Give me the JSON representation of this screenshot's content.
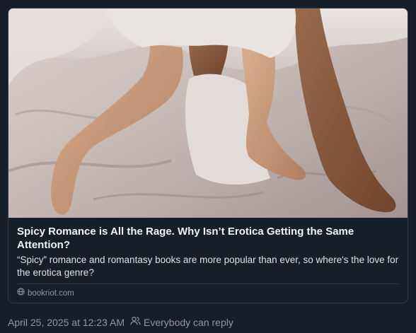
{
  "post": {
    "link_card": {
      "image_alt": "Two pairs of bare legs and feet under rumpled white bed sheets",
      "title": "Spicy Romance is All the Rage. Why Isn’t Erotica Getting the Same Attention?",
      "description": "“Spicy” romance and romantasy books are more popular than ever, so where's the love for the erotica genre?",
      "domain": "bookriot.com",
      "domain_icon": "globe-icon"
    },
    "timestamp": "April 25, 2025 at 12:23 AM",
    "reply_setting": {
      "icon": "people-icon",
      "label": "Everybody can reply"
    }
  },
  "colors": {
    "background": "#161e27",
    "border": "#2e3a48",
    "title_text": "#f1f3f5",
    "muted_text": "#8b98a5"
  }
}
